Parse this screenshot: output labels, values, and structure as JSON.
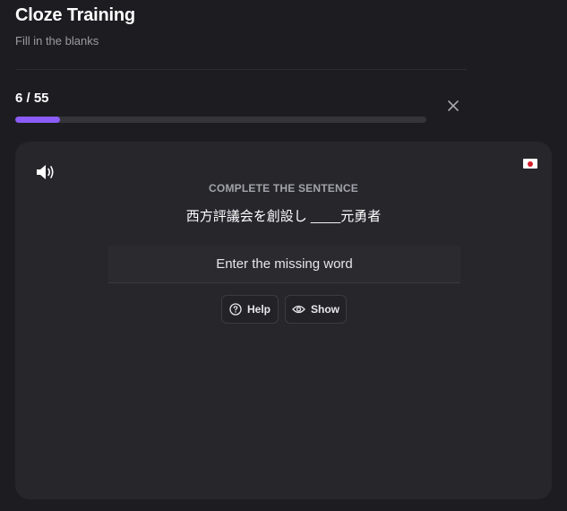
{
  "header": {
    "title": "Cloze Training",
    "subtitle": "Fill in the blanks"
  },
  "progress": {
    "text": "6 / 55",
    "current": 6,
    "total": 55,
    "fraction": 0.109
  },
  "card": {
    "prompt_label": "COMPLETE THE SENTENCE",
    "sentence": "西方評議会を創設し ____元勇者",
    "input": {
      "value": "",
      "placeholder": "Enter the missing word"
    },
    "help_label": "Help",
    "show_label": "Show",
    "language_flag": "japan-flag"
  },
  "icons": {
    "close": "close-icon",
    "speaker": "speaker-icon",
    "help": "question-circle-icon",
    "show": "eye-icon"
  },
  "colors": {
    "background": "#1d1d21",
    "card": "#26262b",
    "accent": "#8b5cf6",
    "track": "#34343a"
  }
}
